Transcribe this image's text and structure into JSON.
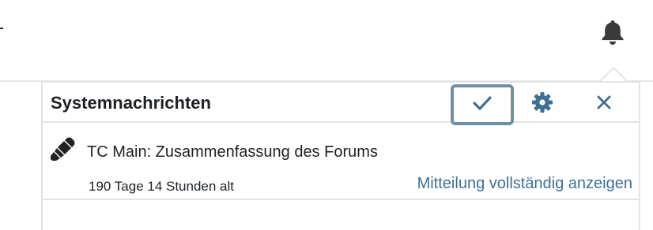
{
  "navbar": {
    "bell_icon": "bell-icon"
  },
  "popover": {
    "title": "Systemnachrichten",
    "actions": {
      "mark_read_icon": "check-icon",
      "settings_icon": "gear-icon",
      "close_icon": "close-icon"
    },
    "notifications": [
      {
        "icon": "highlighter-icon",
        "subject": "TC Main: Zusammenfassung des Forums",
        "age": "190 Tage 14 Stunden alt",
        "link_label": "Mitteilung vollständig anzeigen"
      }
    ]
  },
  "colors": {
    "accent": "#3e6f96",
    "focus_ring": "#6e8fa6",
    "icon_gray": "#3a3a3a",
    "border": "#e3e3e3"
  }
}
